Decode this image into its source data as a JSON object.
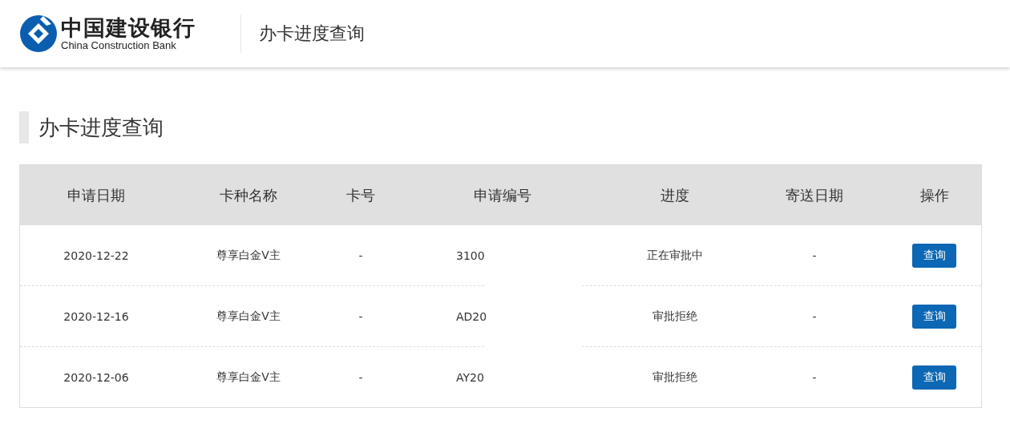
{
  "header": {
    "bank_name_cn": "中国建设银行",
    "bank_name_en": "China Construction Bank",
    "page_title": "办卡进度查询"
  },
  "section_title": "办卡进度查询",
  "table": {
    "columns": [
      "申请日期",
      "卡种名称",
      "卡号",
      "申请编号",
      "进度",
      "寄送日期",
      "操作"
    ],
    "rows": [
      {
        "date": "2020-12-22",
        "card_type": "尊享白金V主",
        "card_no": "-",
        "app_no": "3100",
        "progress": "正在审批中",
        "ship_date": "-",
        "action": "查询"
      },
      {
        "date": "2020-12-16",
        "card_type": "尊享白金V主",
        "card_no": "-",
        "app_no": "AD20",
        "progress": "审批拒绝",
        "ship_date": "-",
        "action": "查询"
      },
      {
        "date": "2020-12-06",
        "card_type": "尊享白金V主",
        "card_no": "-",
        "app_no": "AY20",
        "progress": "审批拒绝",
        "ship_date": "-",
        "action": "查询"
      }
    ]
  }
}
